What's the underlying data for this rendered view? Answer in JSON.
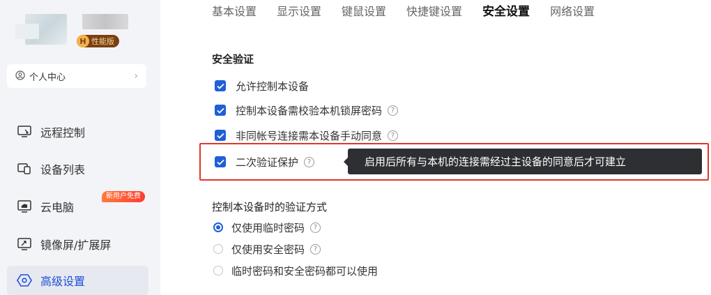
{
  "sidebar": {
    "badge_letter": "H",
    "badge_text": "性能版",
    "profile_label": "个人中心",
    "new_user_badge": "新用户免费",
    "items": [
      {
        "label": "远程控制",
        "icon": "remote-control-icon"
      },
      {
        "label": "设备列表",
        "icon": "device-list-icon"
      },
      {
        "label": "云电脑",
        "icon": "cloud-pc-icon"
      },
      {
        "label": "镜像屏/扩展屏",
        "icon": "mirror-screen-icon"
      },
      {
        "label": "高级设置",
        "icon": "advanced-settings-icon",
        "active": true
      }
    ]
  },
  "tabs": [
    {
      "label": "基本设置"
    },
    {
      "label": "显示设置"
    },
    {
      "label": "键鼠设置"
    },
    {
      "label": "快捷键设置"
    },
    {
      "label": "安全设置",
      "active": true
    },
    {
      "label": "网络设置"
    }
  ],
  "security": {
    "title": "安全验证",
    "options": [
      {
        "label": "允许控制本设备",
        "checked": true,
        "help": false
      },
      {
        "label": "控制本设备需校验本机锁屏密码",
        "checked": true,
        "help": true
      },
      {
        "label": "非同帐号连接需本设备手动同意",
        "checked": true,
        "help": true
      },
      {
        "label": "二次验证保护",
        "checked": true,
        "help": true
      }
    ],
    "tooltip": "启用后所有与本机的连接需经过主设备的同意后才可建立"
  },
  "verify": {
    "title": "控制本设备时的验证方式",
    "options": [
      {
        "label": "仅使用临时密码",
        "checked": true,
        "help": true
      },
      {
        "label": "仅使用安全密码",
        "checked": false,
        "help": true
      },
      {
        "label": "临时密码和安全密码都可以使用",
        "checked": false,
        "help": false
      }
    ]
  },
  "colors": {
    "accent": "#1f5fd8",
    "highlight": "#e0362c",
    "tooltip_bg": "#2d2f33"
  }
}
